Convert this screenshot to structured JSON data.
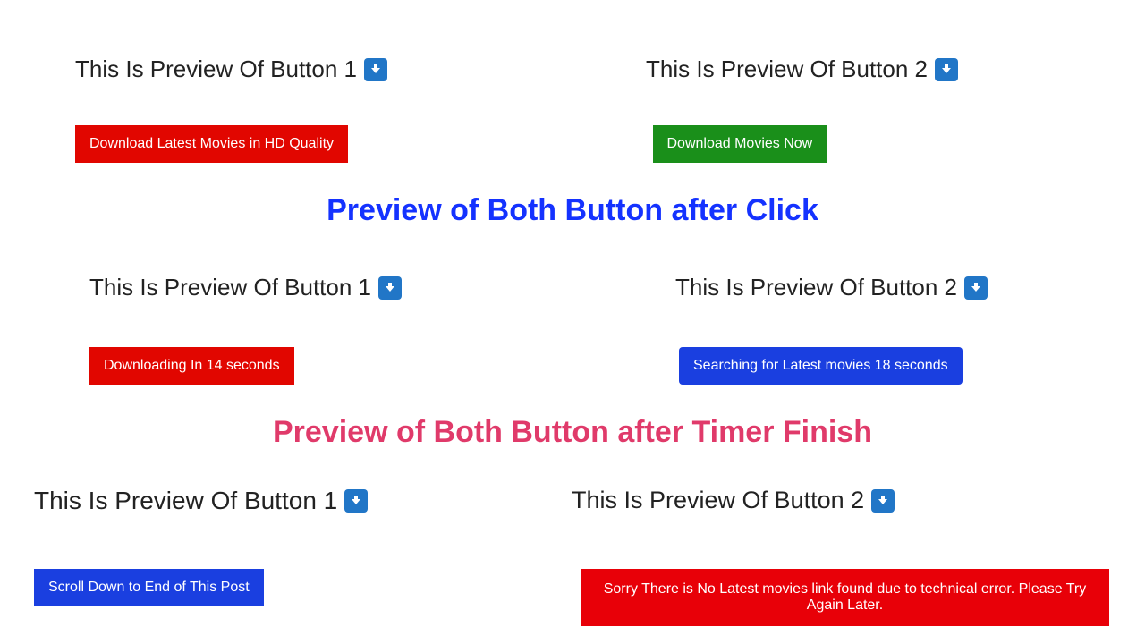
{
  "section1": {
    "left_title": "This Is Preview Of Button 1",
    "right_title": "This Is Preview Of Button 2",
    "left_button": "Download Latest Movies in HD Quality",
    "right_button": "Download Movies Now"
  },
  "heading_after_click": "Preview of Both Button after Click",
  "section2": {
    "left_title": "This Is Preview Of Button 1",
    "right_title": "This Is Preview Of Button 2",
    "left_button": "Downloading In 14 seconds",
    "right_button": "Searching for Latest movies 18 seconds"
  },
  "heading_after_timer": "Preview of Both Button after Timer Finish",
  "section3": {
    "left_title": "This Is Preview Of Button 1",
    "right_title": "This Is Preview Of Button 2",
    "left_button": "Scroll Down to End of This Post",
    "right_message": "Sorry There is No Latest movies link found due to technical error. Please Try Again Later."
  }
}
